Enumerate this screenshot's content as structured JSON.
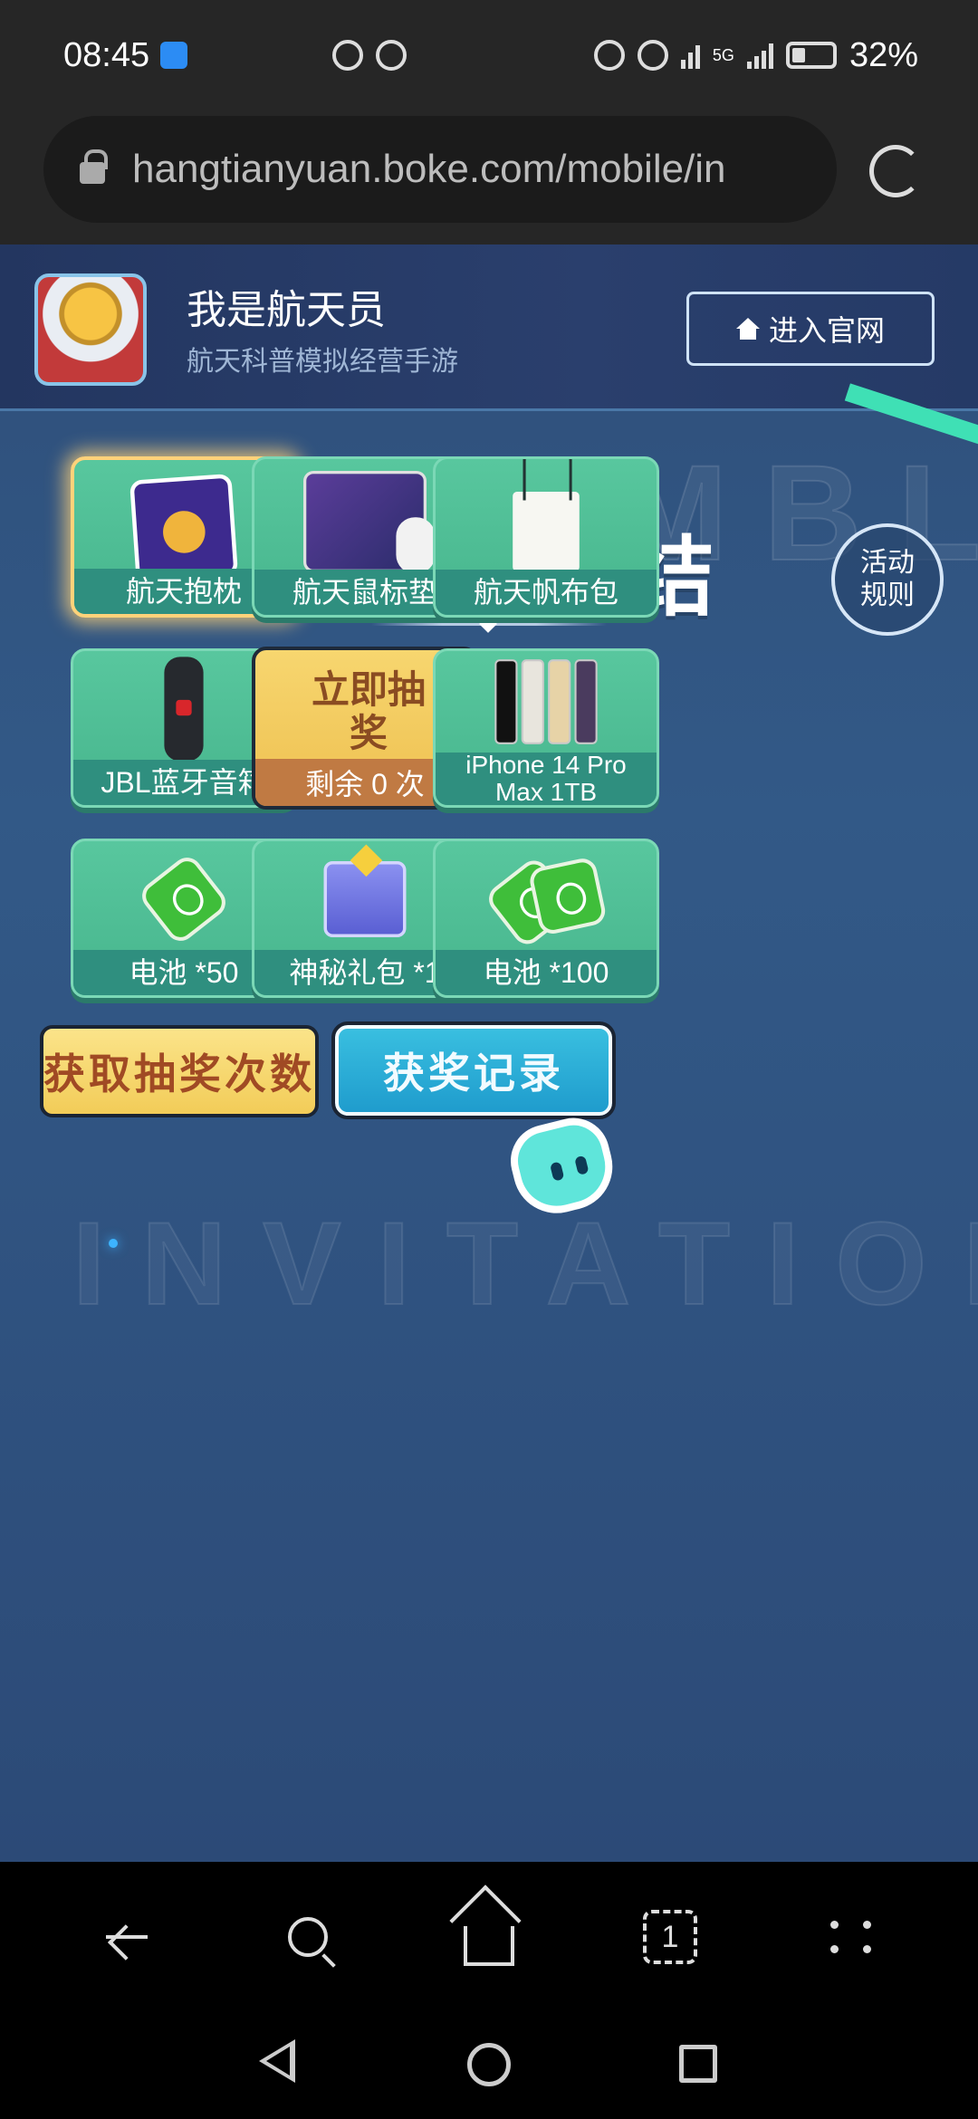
{
  "status_bar": {
    "time": "08:45",
    "network": "5G",
    "battery": "32%"
  },
  "browser": {
    "url": "hangtianyuan.boke.com/mobile/in"
  },
  "header": {
    "app_name": "我是航天员",
    "app_subtitle": "航天科普模拟经营手游",
    "enter_site_label": "进入官网"
  },
  "event": {
    "bg_word_top": "ASSEMBLY",
    "title": "航天员集结",
    "rules_label": "活动规则",
    "bg_word_bottom": "INVITATION"
  },
  "prizes": [
    {
      "label": "航天抱枕",
      "icon": "pillow-icon",
      "selected": true
    },
    {
      "label": "航天鼠标垫",
      "icon": "mousepad-icon"
    },
    {
      "label": "航天帆布包",
      "icon": "tote-bag-icon"
    },
    {
      "label": "JBL蓝牙音箱",
      "icon": "speaker-icon"
    },
    {
      "label": "iPhone 14 Pro Max 1TB",
      "icon": "iphone-icon"
    },
    {
      "label": "电池 *50",
      "icon": "battery-icon"
    },
    {
      "label": "神秘礼包 *1",
      "icon": "mystery-box-icon"
    },
    {
      "label": "电池 *100",
      "icon": "battery-pack-icon"
    }
  ],
  "draw": {
    "label": "立即抽奖",
    "remaining": "剩余 0 次"
  },
  "actions": {
    "get_chances": "获取抽奖次数",
    "records": "获奖记录"
  },
  "toolbar": {
    "tab_count": "1"
  },
  "colors": {
    "card_green": "#58c79e",
    "label_teal": "#2f8f7f",
    "draw_gold": "#eec050",
    "button_blue": "#1f9ccd",
    "page_blue": "#325987"
  }
}
